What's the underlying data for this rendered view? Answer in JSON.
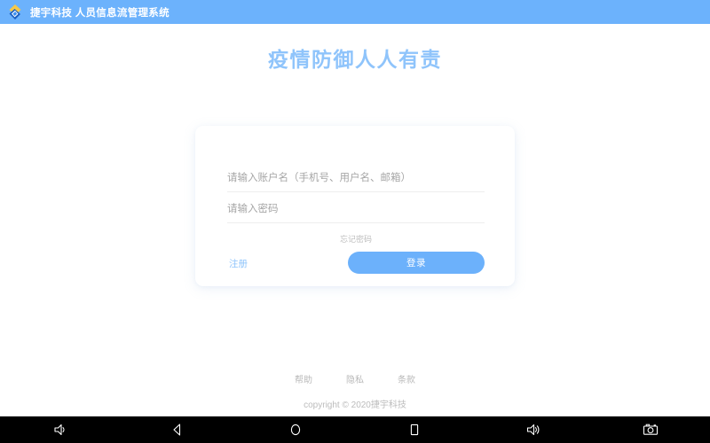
{
  "app_bar": {
    "logo_icon": "diamond-logo-icon",
    "title": "捷宇科技 人员信息流管理系统",
    "background_color": "#6cb2fc"
  },
  "page": {
    "title": "疫情防御人人有责",
    "title_color": "#8fc4fb",
    "background_color": "#ffffff"
  },
  "login_card": {
    "account_placeholder": "请输入账户名（手机号、用户名、邮箱）",
    "account_value": "",
    "password_placeholder": "请输入密码",
    "password_value": "",
    "forgot_label": "忘记密码",
    "register_label": "注册",
    "login_label": "登录",
    "login_button_color": "#6cb1fb",
    "link_color": "#8fc4fb"
  },
  "footer": {
    "links": [
      {
        "label": "帮助"
      },
      {
        "label": "隐私"
      },
      {
        "label": "条款"
      }
    ],
    "copyright": "copyright © 2020捷宇科技"
  },
  "nav_bar": {
    "buttons": [
      {
        "name": "volume-down-icon"
      },
      {
        "name": "back-icon"
      },
      {
        "name": "home-icon"
      },
      {
        "name": "recents-icon"
      },
      {
        "name": "volume-up-icon"
      },
      {
        "name": "screenshot-icon"
      }
    ]
  }
}
